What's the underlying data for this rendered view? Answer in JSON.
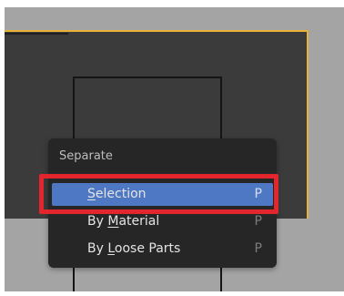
{
  "menu": {
    "title": "Separate",
    "items": [
      {
        "first": "",
        "underline": "S",
        "rest": "election",
        "shortcut": "P",
        "state": "highlighted"
      },
      {
        "first": "By ",
        "underline": "M",
        "rest": "aterial",
        "shortcut": "P",
        "state": "normal"
      },
      {
        "first": "By ",
        "underline": "L",
        "rest": "oose Parts",
        "shortcut": "P",
        "state": "normal"
      }
    ]
  },
  "colors": {
    "viewport_bg": "#a4a4a4",
    "mesh_face": "#3b3b3b",
    "selected_edge": "#e8b236",
    "menu_bg": "#262626",
    "highlight_item": "#4f78c4",
    "annotation_box": "#e3262e"
  }
}
